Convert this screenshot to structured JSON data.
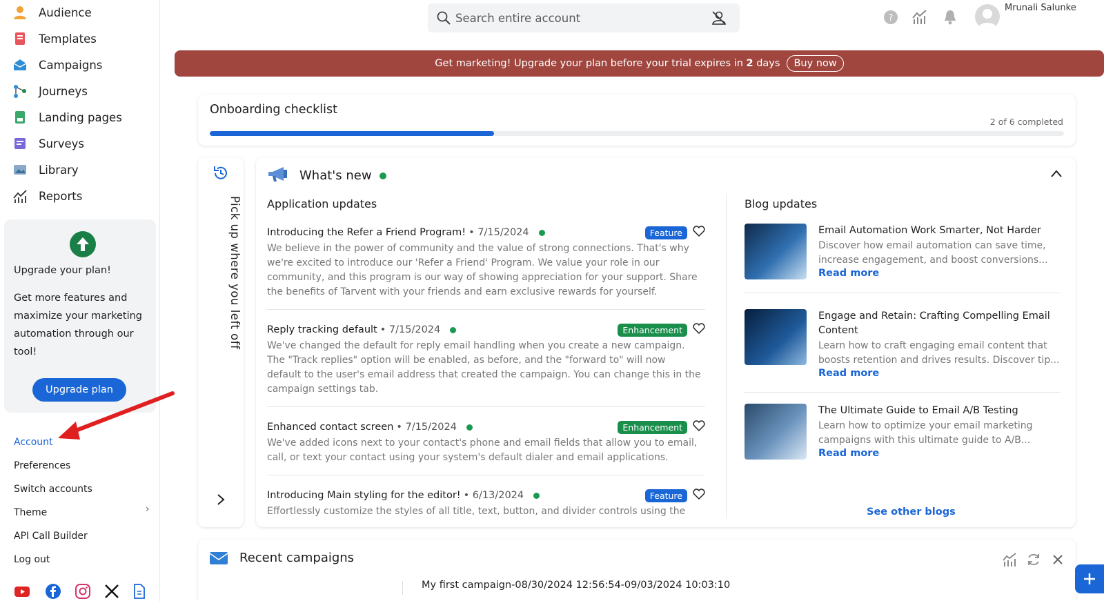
{
  "sidebar": {
    "items": [
      {
        "label": "Audience"
      },
      {
        "label": "Templates"
      },
      {
        "label": "Campaigns"
      },
      {
        "label": "Journeys"
      },
      {
        "label": "Landing pages"
      },
      {
        "label": "Surveys"
      },
      {
        "label": "Library"
      },
      {
        "label": "Reports"
      }
    ],
    "upgrade": {
      "title": "Upgrade your plan!",
      "description": "Get more features and maximize your marketing automation through our tool!",
      "button": "Upgrade plan"
    },
    "menu": {
      "account": "Account",
      "preferences": "Preferences",
      "switch_accounts": "Switch accounts",
      "theme": "Theme",
      "api_call_builder": "API Call Builder",
      "log_out": "Log out"
    }
  },
  "header": {
    "search_placeholder": "Search entire account",
    "user_name": "Mrunali Salunke"
  },
  "banner": {
    "text_before": "Get marketing! Upgrade your plan before your trial expires in",
    "days": "2",
    "text_after": "days",
    "buy_button": "Buy now"
  },
  "onboarding": {
    "title": "Onboarding checklist",
    "progress_text": "2 of 6 completed",
    "progress_fraction": 0.333
  },
  "pickup": {
    "label": "Pick up where you left off"
  },
  "whats_new": {
    "title": "What's new",
    "application_updates_title": "Application updates",
    "updates": [
      {
        "title": "Introducing the Refer a Friend Program!",
        "date": "7/15/2024",
        "badge": "Feature",
        "body": "We believe in the power of community and the value of strong connections. That's why we're excited to introduce our 'Refer a Friend' Program. We value your role in our community, and this program is our way of showing appreciation for your support. Share the benefits of Tarvent with your friends and earn exclusive rewards for yourself."
      },
      {
        "title": "Reply tracking default",
        "date": "7/15/2024",
        "badge": "Enhancement",
        "body": "We've changed the default for reply email handling when you create a new campaign. The \"Track replies\" option will be enabled, as before, and the \"forward to\" will now default to the user's email address that created the campaign. You can change this in the campaign settings tab."
      },
      {
        "title": "Enhanced contact screen",
        "date": "7/15/2024",
        "badge": "Enhancement",
        "body": "We've added icons next to your contact's phone and email fields that allow you to email, call, or text your contact using your system's default dialer and email applications."
      },
      {
        "title": "Introducing Main styling for the editor!",
        "date": "6/13/2024",
        "badge": "Feature",
        "body": "Effortlessly customize the styles of all title, text, button, and divider controls using the"
      }
    ],
    "blog_updates_title": "Blog updates",
    "blogs": [
      {
        "title": "Email Automation Work Smarter, Not Harder",
        "desc": "Discover how email automation can save time, increase engagement, and boost conversions...",
        "read_more": "Read more"
      },
      {
        "title": "Engage and Retain: Crafting Compelling Email Content",
        "desc": "Learn how to craft engaging email content that boosts retention and drives results. Discover tip...",
        "read_more": "Read more"
      },
      {
        "title": "The Ultimate Guide to Email A/B Testing",
        "desc": "Learn how to optimize your email marketing campaigns with this ultimate guide to A/B...",
        "read_more": "Read more"
      }
    ],
    "see_other_blogs": "See other blogs"
  },
  "recent_campaigns": {
    "title": "Recent campaigns",
    "item": "My first campaign-08/30/2024 12:56:54-09/03/2024 10:03:10"
  },
  "colors": {
    "primary": "#1a66d6",
    "success": "#1a8f4c",
    "banner": "#a0463f"
  }
}
